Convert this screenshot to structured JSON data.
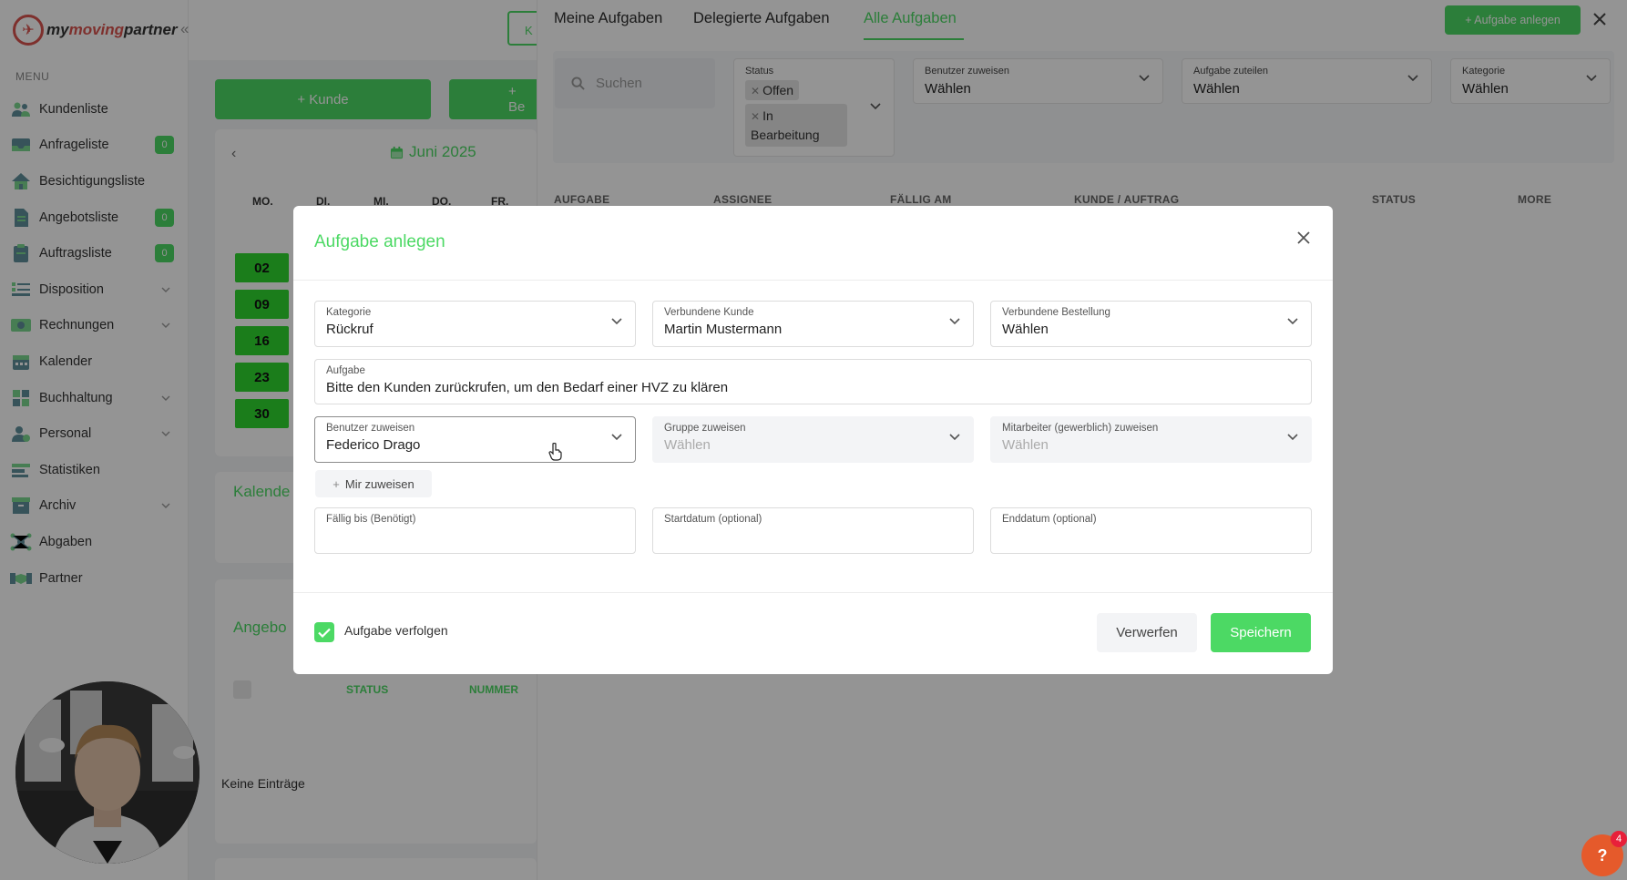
{
  "app": {
    "logo_text": "mymovingpartner",
    "logo_text_prefix": "my",
    "logo_text_brand": "moving",
    "logo_text_suffix": "partner"
  },
  "sidebar": {
    "menu_label": "MENU",
    "items": [
      {
        "label": "Kundenliste",
        "icon": "users-icon"
      },
      {
        "label": "Anfrageliste",
        "icon": "inbox-icon",
        "badge": "0"
      },
      {
        "label": "Besichtigungsliste",
        "icon": "home-icon"
      },
      {
        "label": "Angebotsliste",
        "icon": "document-icon",
        "badge": "0"
      },
      {
        "label": "Auftragsliste",
        "icon": "clipboard-icon",
        "badge": "0"
      },
      {
        "label": "Disposition",
        "icon": "list-icon",
        "expandable": true
      },
      {
        "label": "Rechnungen",
        "icon": "money-icon",
        "expandable": true
      },
      {
        "label": "Kalender",
        "icon": "calendar-icon"
      },
      {
        "label": "Buchhaltung",
        "icon": "grid-icon",
        "expandable": true
      },
      {
        "label": "Personal",
        "icon": "person-icon",
        "expandable": true
      },
      {
        "label": "Statistiken",
        "icon": "stats-icon"
      },
      {
        "label": "Archiv",
        "icon": "archive-icon",
        "expandable": true
      },
      {
        "label": "Abgaben",
        "icon": "network-icon"
      },
      {
        "label": "Partner",
        "icon": "handshake-icon"
      }
    ]
  },
  "dashboard": {
    "btn_kunde": "+ Kunde",
    "btn_be": "+ Be",
    "toolbar_ku": "K",
    "calendar": {
      "month": "Juni 2025",
      "weekdays": [
        "MO.",
        "DI.",
        "MI.",
        "DO.",
        "FR."
      ],
      "days": [
        "02",
        "09",
        "16",
        "23",
        "30"
      ]
    },
    "kalender_title": "Kalende",
    "angebote_title": "Angebo",
    "table_headers": [
      "STATUS",
      "NUMMER"
    ],
    "empty_text": "Keine Einträge"
  },
  "tasks_panel": {
    "tabs": [
      "Meine Aufgaben",
      "Delegierte Aufgaben",
      "Alle Aufgaben"
    ],
    "active_tab": "Alle Aufgaben",
    "create_button": "+ Aufgabe anlegen",
    "search_placeholder": "Suchen",
    "filters": {
      "status_label": "Status",
      "status_chips": [
        "Offen",
        "In Bearbeitung"
      ],
      "benutzer_label": "Benutzer zuweisen",
      "benutzer_value": "Wählen",
      "zuteilen_label": "Aufgabe zuteilen",
      "zuteilen_value": "Wählen",
      "kategorie_label": "Kategorie",
      "kategorie_value": "Wählen"
    },
    "columns": [
      "AUFGABE",
      "ASSIGNEE",
      "FÄLLIG AM",
      "KUNDE / AUFTRAG",
      "STATUS",
      "MORE"
    ]
  },
  "modal": {
    "title": "Aufgabe anlegen",
    "kategorie": {
      "label": "Kategorie",
      "value": "Rückruf"
    },
    "kunde": {
      "label": "Verbundene Kunde",
      "value": "Martin Mustermann"
    },
    "bestellung": {
      "label": "Verbundene Bestellung",
      "value": "Wählen"
    },
    "aufgabe": {
      "label": "Aufgabe",
      "value": "Bitte den Kunden zurückrufen, um den Bedarf einer HVZ zu klären"
    },
    "benutzer": {
      "label": "Benutzer zuweisen",
      "value": "Federico Drago"
    },
    "gruppe": {
      "label": "Gruppe zuweisen",
      "value": "Wählen"
    },
    "mitarbeiter": {
      "label": "Mitarbeiter (gewerblich) zuweisen",
      "value": "Wählen"
    },
    "mir_zuweisen": "Mir zuweisen",
    "faellig": {
      "label": "Fällig bis (Benötigt)",
      "value": ""
    },
    "start": {
      "label": "Startdatum (optional)",
      "value": ""
    },
    "end": {
      "label": "Enddatum (optional)",
      "value": ""
    },
    "verfolgen_label": "Aufgabe verfolgen",
    "verfolgen_checked": true,
    "discard_label": "Verwerfen",
    "save_label": "Speichern"
  },
  "help": {
    "label": "?",
    "badge": "4"
  },
  "colors": {
    "accent": "#4cd964",
    "day_highlight": "#2fd82f",
    "logo_red": "#d9534f",
    "help": "#e55a2b"
  }
}
